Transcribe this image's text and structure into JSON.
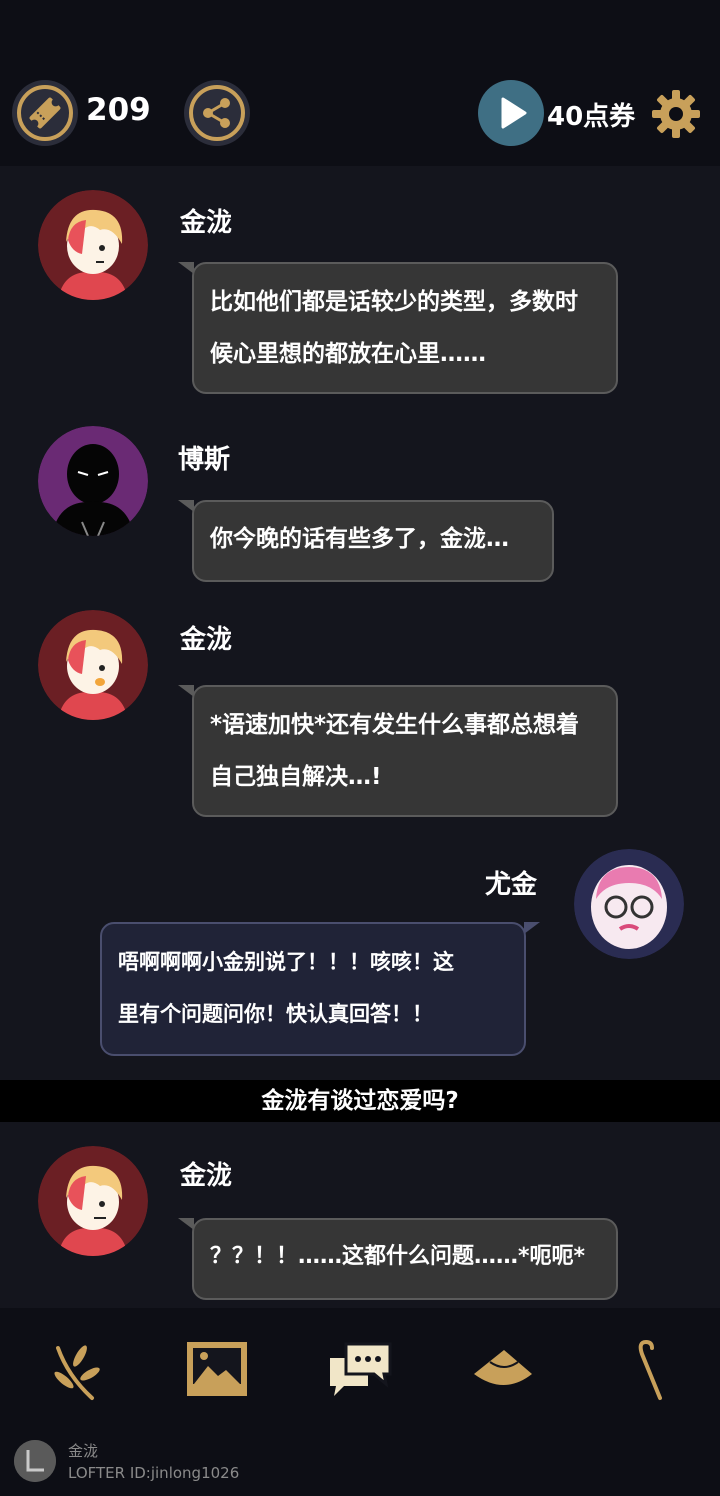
{
  "header": {
    "ticket_count": "209",
    "points_label": "40点券",
    "icons": [
      "ticket-icon",
      "share-icon",
      "play-icon",
      "gear-icon"
    ],
    "accent_color": "#c8a05a"
  },
  "messages": [
    {
      "speaker": "金泷",
      "line1": "比如他们都是话较少的类型，多数时",
      "line2": "候心里想的都放在心里……"
    },
    {
      "speaker": "博斯",
      "line1": "你今晚的话有些多了，金泷…"
    },
    {
      "speaker": "金泷",
      "line1": "*语速加快*还有发生什么事都总想着",
      "line2": "自己独自解决…!"
    },
    {
      "speaker": "尤金",
      "line1": "唔啊啊啊小金别说了！！！咳咳！这",
      "line2": "里有个问题问你！快认真回答！！"
    },
    {
      "speaker": "金泷",
      "line1": "？？！！……这都什么问题……*呃呃*"
    }
  ],
  "question": "金泷有谈过恋爱吗?",
  "bottom_nav": {
    "icons": [
      "branch-icon",
      "image-icon",
      "chat-icon",
      "hat-icon",
      "cane-icon"
    ]
  },
  "footer": {
    "name": "金泷",
    "id": "LOFTER ID:jinlong1026"
  }
}
